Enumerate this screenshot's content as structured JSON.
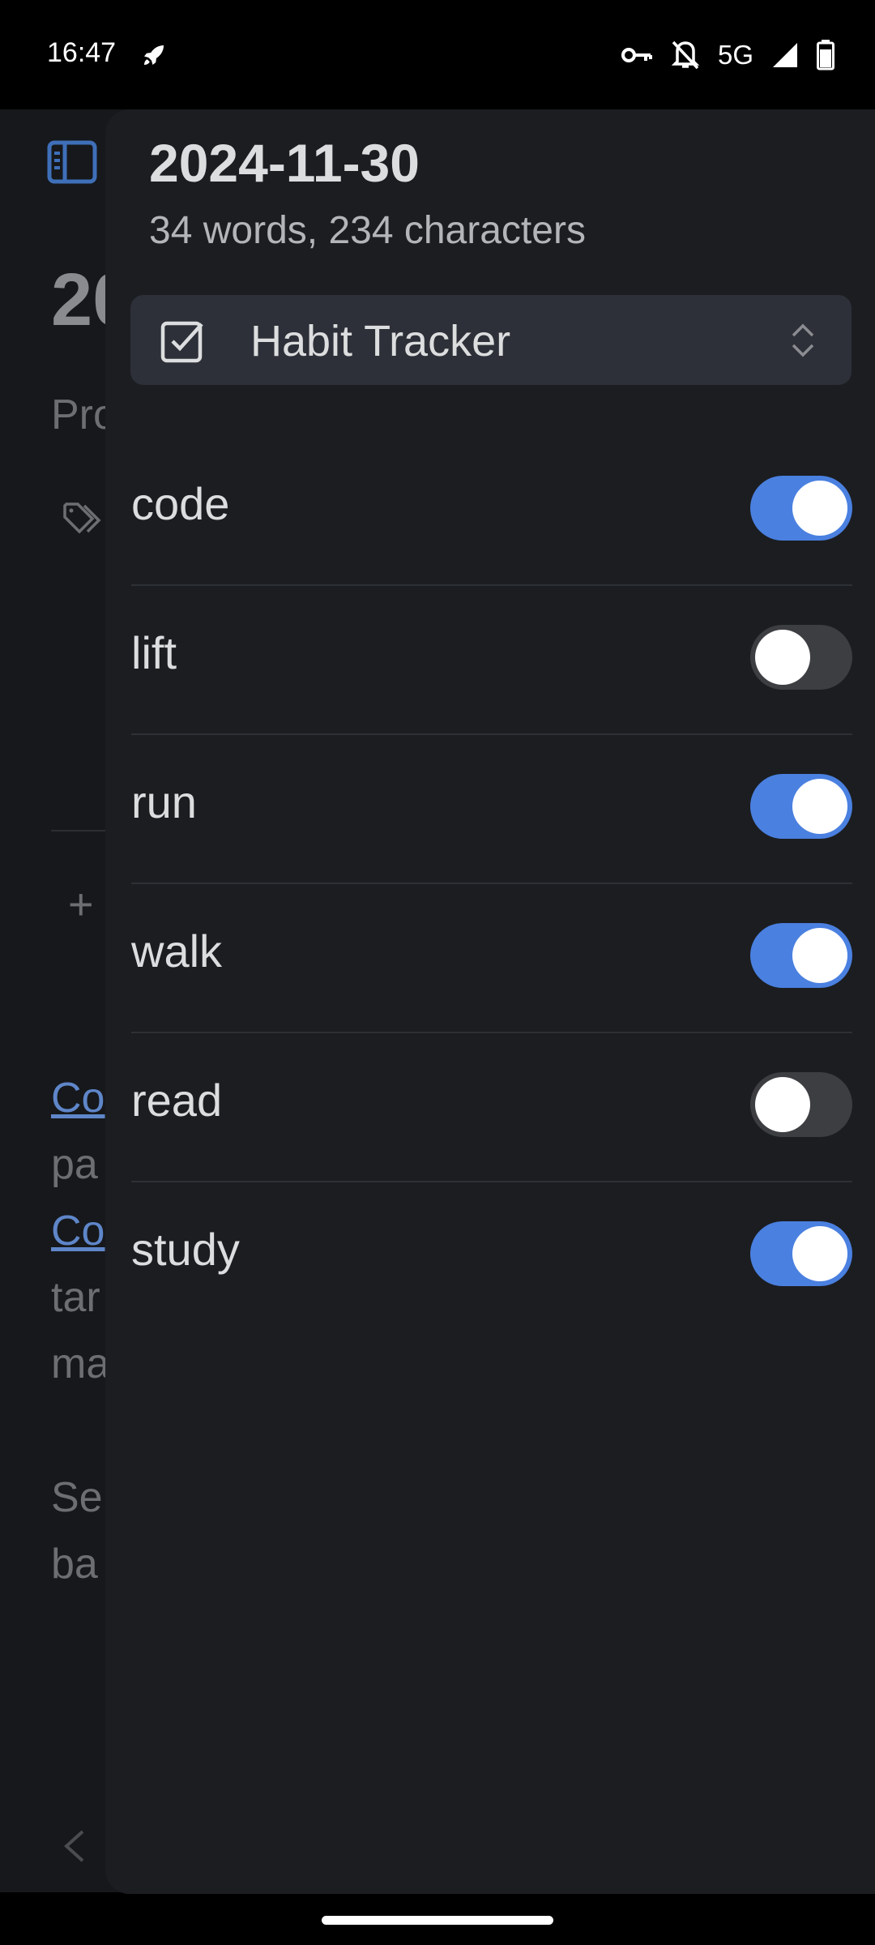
{
  "status_bar": {
    "time": "16:47",
    "network": "5G",
    "icons": [
      "rocket-icon",
      "vpn-key-icon",
      "mute-icon",
      "signal-icon",
      "battery-icon"
    ]
  },
  "background_page": {
    "title_fragment": "20",
    "property_fragment": "Pro",
    "lines": [
      {
        "text": "Co",
        "link": true
      },
      {
        "text": "pa",
        "link": false
      },
      {
        "text": "Co",
        "link": true
      },
      {
        "text": "tar",
        "link": false
      },
      {
        "text": "ma",
        "link": false
      },
      {
        "text": "Se",
        "link": false
      },
      {
        "text": "ba",
        "link": false
      }
    ],
    "plus": "+"
  },
  "drawer": {
    "title": "2024-11-30",
    "subtitle": "34 words, 234 characters",
    "selector": {
      "label": "Habit Tracker",
      "icon": "checkbox-icon"
    },
    "habits": [
      {
        "label": "code",
        "on": true
      },
      {
        "label": "lift",
        "on": false
      },
      {
        "label": "run",
        "on": true
      },
      {
        "label": "walk",
        "on": true
      },
      {
        "label": "read",
        "on": false
      },
      {
        "label": "study",
        "on": true
      }
    ]
  },
  "colors": {
    "accent": "#4a80e0",
    "drawer_bg": "#1b1d21",
    "toggle_off": "#3d3e42"
  }
}
